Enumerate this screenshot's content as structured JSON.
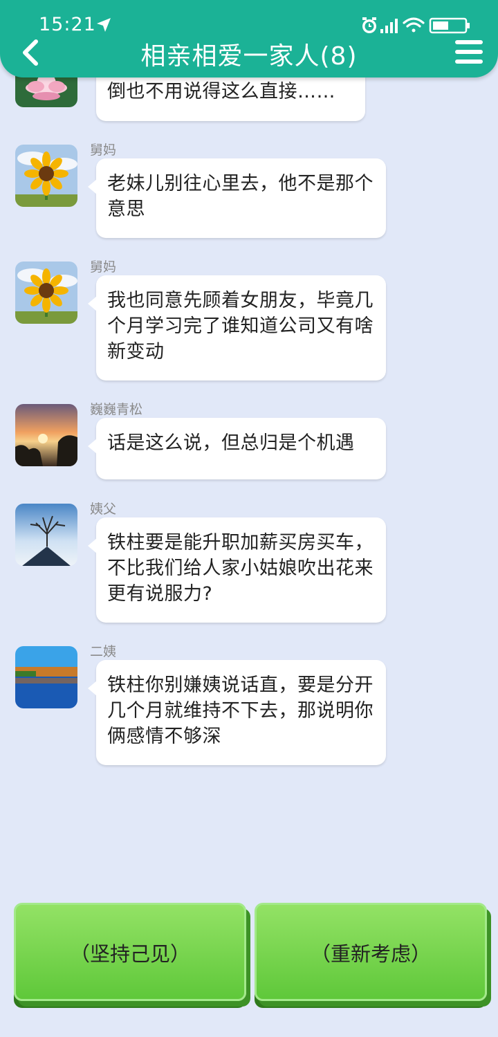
{
  "status_bar": {
    "time": "15:21"
  },
  "header": {
    "title": "相亲相爱一家人(8)"
  },
  "messages": [
    {
      "sender": "",
      "avatar": "lotus-avatar",
      "text": "倒也不用说得这么直接……"
    },
    {
      "sender": "舅妈",
      "avatar": "sunflower-avatar",
      "text": "老妹儿别往心里去，他不是那个意思"
    },
    {
      "sender": "舅妈",
      "avatar": "sunflower-avatar",
      "text": "我也同意先顾着女朋友，毕竟几个月学习完了谁知道公司又有啥新变动"
    },
    {
      "sender": "巍巍青松",
      "avatar": "sunset-avatar",
      "text": "话是这么说，但总归是个机遇"
    },
    {
      "sender": "姨父",
      "avatar": "tree-avatar",
      "text": "铁柱要是能升职加薪买房买车，不比我们给人家小姑娘吹出花来更有说服力?"
    },
    {
      "sender": "二姨",
      "avatar": "lake-avatar",
      "text": "铁柱你别嫌姨说话直，要是分开几个月就维持不下去，那说明你俩感情不够深"
    }
  ],
  "choices": {
    "left": "（坚持己见）",
    "right": "（重新考虑）"
  },
  "colors": {
    "header": "#1bb296",
    "background": "#e1e8f8",
    "button": "#7ed957"
  }
}
